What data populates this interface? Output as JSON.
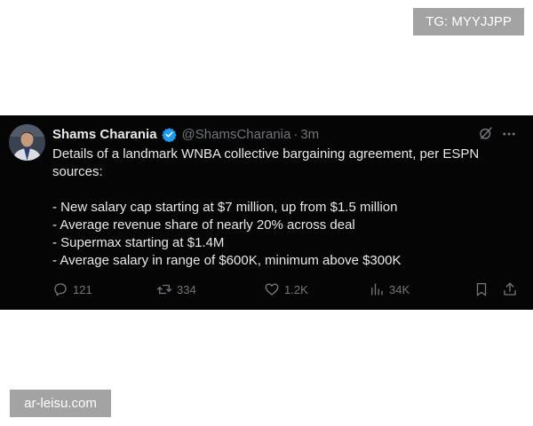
{
  "watermarks": {
    "top": "TG: MYYJJPP",
    "bottom": "ar-leisu.com"
  },
  "tweet": {
    "display_name": "Shams Charania",
    "handle": "@ShamsCharania",
    "separator": "·",
    "time": "3m",
    "lines": [
      "Details of a landmark WNBA collective bargaining agreement, per ESPN",
      "sources:",
      "",
      "- New salary cap starting at $7 million, up from $1.5 million",
      "- Average revenue share of nearly 20% across deal",
      "- Supermax starting at $1.4M",
      "- Average salary in range of $600K, minimum above $300K"
    ],
    "actions": {
      "replies": "121",
      "reposts": "334",
      "likes": "1.2K",
      "views": "34K"
    }
  },
  "colors": {
    "tweet_bg": "#050505",
    "text": "#e7e9ea",
    "muted": "#71767b",
    "verified": "#1d9bf0",
    "watermark_bg": "#a3a3a3"
  },
  "icons": [
    "verified-badge-icon",
    "grok-icon",
    "more-icon",
    "reply-icon",
    "repost-icon",
    "like-icon",
    "views-icon",
    "bookmark-icon",
    "share-icon"
  ]
}
